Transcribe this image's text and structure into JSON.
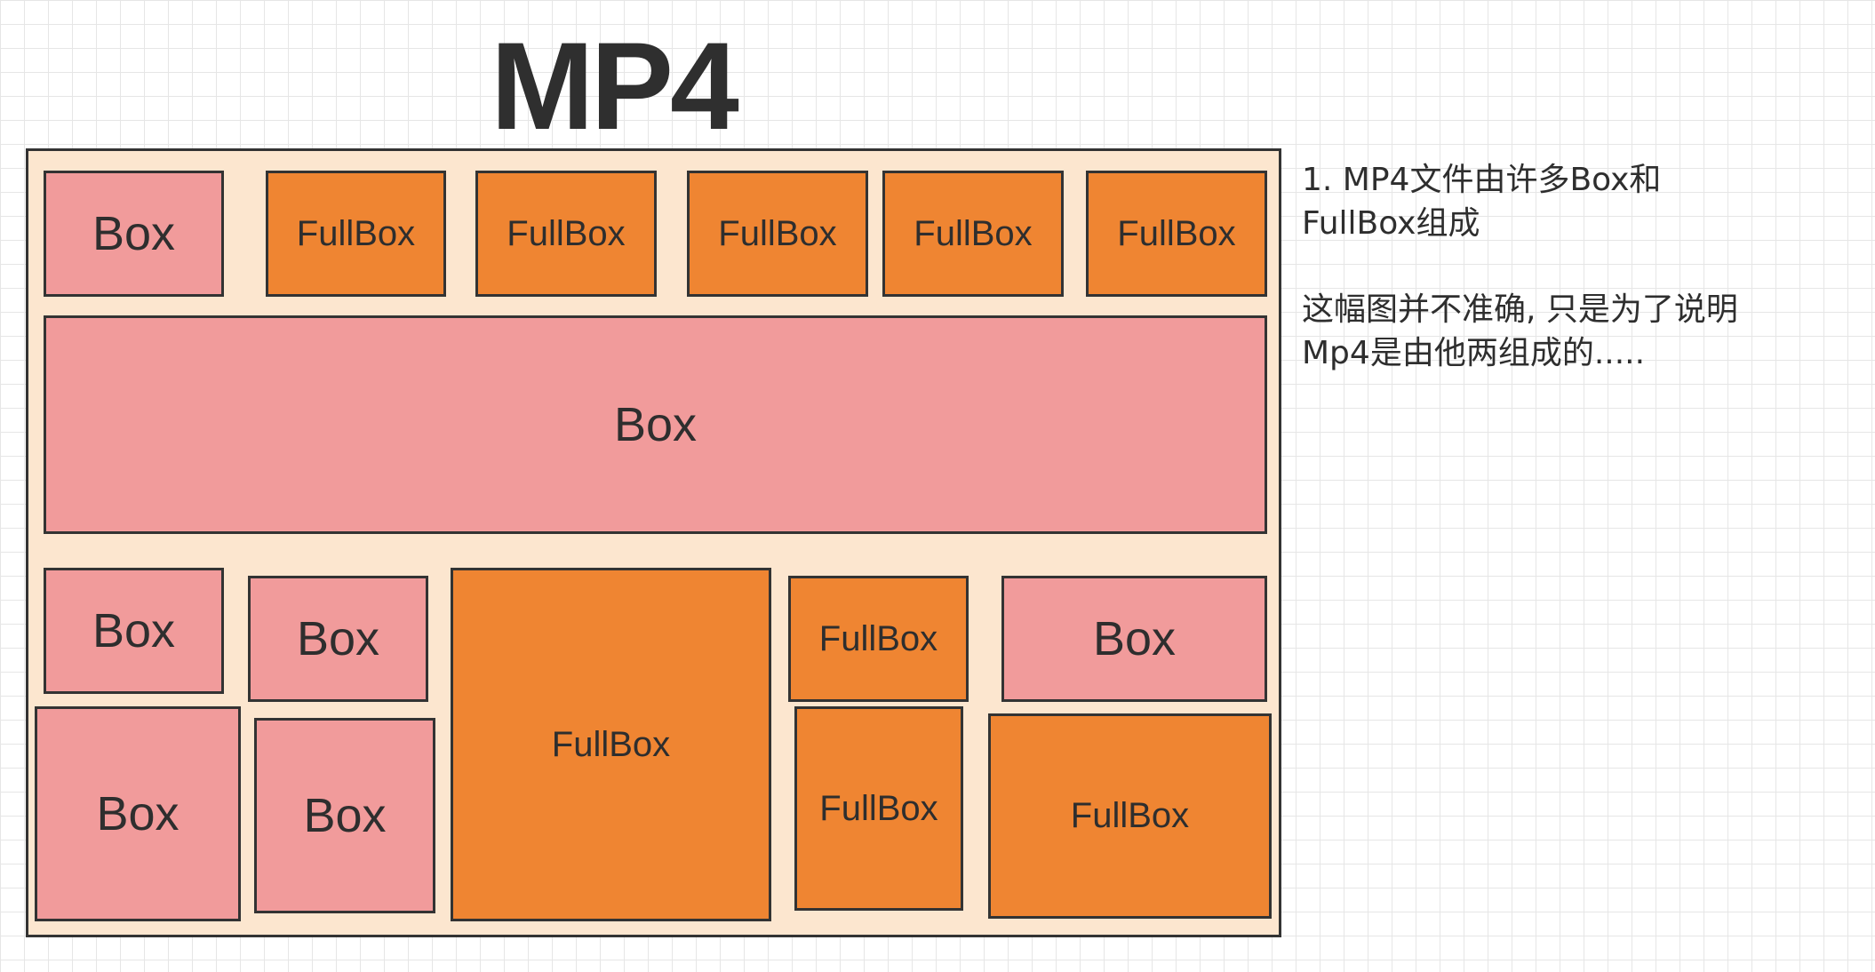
{
  "title": "MP4",
  "container": {
    "boxes": [
      {
        "label": "Box",
        "kind": "box"
      },
      {
        "label": "FullBox",
        "kind": "fullbox"
      },
      {
        "label": "FullBox",
        "kind": "fullbox"
      },
      {
        "label": "FullBox",
        "kind": "fullbox"
      },
      {
        "label": "FullBox",
        "kind": "fullbox"
      },
      {
        "label": "FullBox",
        "kind": "fullbox"
      },
      {
        "label": "Box",
        "kind": "box"
      },
      {
        "label": "Box",
        "kind": "box"
      },
      {
        "label": "Box",
        "kind": "box"
      },
      {
        "label": "FullBox",
        "kind": "fullbox"
      },
      {
        "label": "FullBox",
        "kind": "fullbox"
      },
      {
        "label": "Box",
        "kind": "box"
      },
      {
        "label": "Box",
        "kind": "box"
      },
      {
        "label": "Box",
        "kind": "box"
      },
      {
        "label": "FullBox",
        "kind": "fullbox"
      },
      {
        "label": "FullBox",
        "kind": "fullbox"
      }
    ]
  },
  "notes": {
    "note1_line1": "1. MP4文件由许多Box和",
    "note1_line2": "FullBox组成",
    "note2_line1": "这幅图并不准确, 只是为了说明",
    "note2_line2": "Mp4是由他两组成的....."
  },
  "colors": {
    "box": "#f19b9b",
    "fullbox": "#ef8532",
    "container": "#fce6cf",
    "border": "#333333"
  }
}
